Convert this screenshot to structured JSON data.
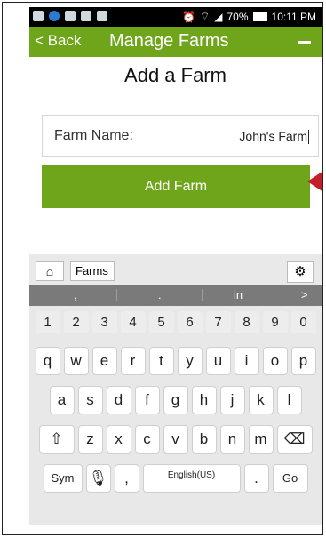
{
  "status_bar": {
    "battery": "70%",
    "time": "10:11 PM"
  },
  "app_bar": {
    "back_label": "< Back",
    "title": "Manage Farms",
    "menu_label": "—"
  },
  "heading": "Add a Farm",
  "form": {
    "label": "Farm Name:",
    "value": "John's Farm"
  },
  "add_button": "Add Farm",
  "keyboard": {
    "suggestion_word": "Farms",
    "predictions": [
      ",",
      ".",
      "in",
      ">"
    ],
    "numbers": [
      "1",
      "2",
      "3",
      "4",
      "5",
      "6",
      "7",
      "8",
      "9",
      "0"
    ],
    "row1": [
      "q",
      "w",
      "e",
      "r",
      "t",
      "y",
      "u",
      "i",
      "o",
      "p"
    ],
    "row2": [
      "a",
      "s",
      "d",
      "f",
      "g",
      "h",
      "j",
      "k",
      "l"
    ],
    "row3": [
      "z",
      "x",
      "c",
      "v",
      "b",
      "n",
      "m"
    ],
    "sym": "Sym",
    "comma": ",",
    "space_label": "English(US)",
    "period": ".",
    "go": "Go"
  }
}
